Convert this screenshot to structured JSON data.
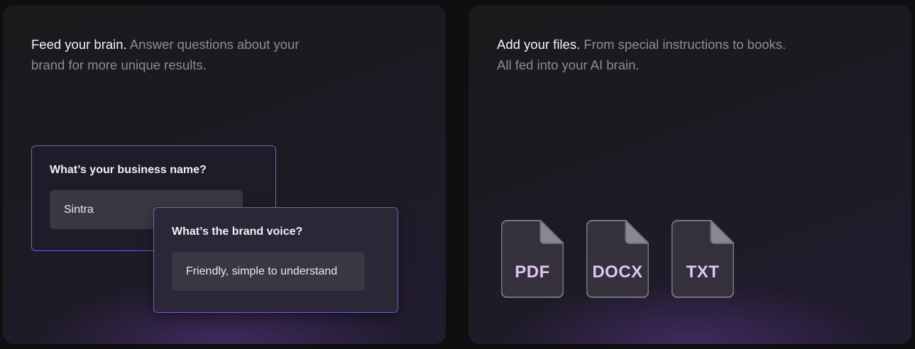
{
  "left_card": {
    "heading_lead": "Feed your brain.",
    "heading_rest": " Answer questions about your brand for more unique results.",
    "question_1": {
      "label": "What’s your business name?",
      "value": "Sintra"
    },
    "question_2": {
      "label": "What’s the brand voice?",
      "value": "Friendly, simple to understand"
    }
  },
  "right_card": {
    "heading_lead": "Add your files.",
    "heading_rest": " From special instructions to books. All fed into your AI brain.",
    "files": [
      {
        "label": "PDF",
        "icon": "document-icon"
      },
      {
        "label": "DOCX",
        "icon": "document-icon"
      },
      {
        "label": "TXT",
        "icon": "document-icon"
      }
    ]
  },
  "colors": {
    "background": "#0f0f10",
    "accent_border": "#7a5ad0",
    "file_label": "#dcc6f7"
  }
}
